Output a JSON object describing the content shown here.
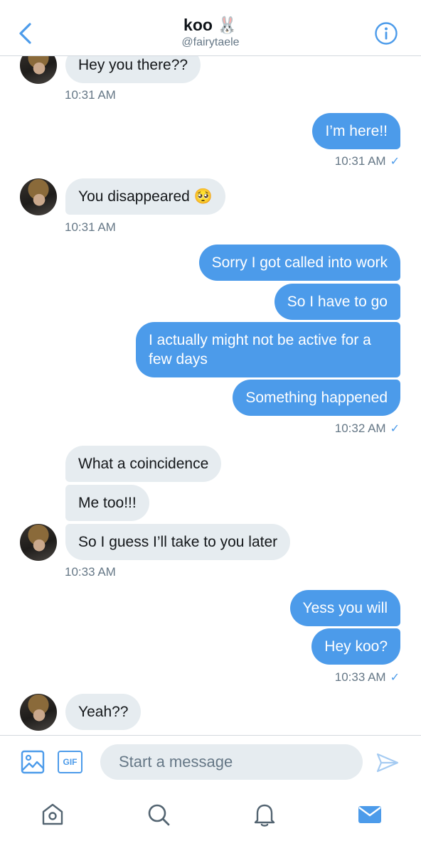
{
  "header": {
    "title": "koo 🐰",
    "handle": "@fairytaele"
  },
  "messages": [
    {
      "side": "in",
      "text": "Hey you there??"
    },
    {
      "side": "meta",
      "text": "10:31 AM"
    },
    {
      "side": "out",
      "text": "I’m here!!"
    },
    {
      "side": "meta",
      "text": "10:31 AM",
      "read": "✓"
    },
    {
      "side": "in",
      "text": "You disappeared 🥺"
    },
    {
      "side": "meta",
      "text": "10:31 AM"
    },
    {
      "side": "out",
      "text": "Sorry I got called into work"
    },
    {
      "side": "out",
      "text": "So I have to go"
    },
    {
      "side": "out",
      "text": "I actually might not be active for a few days"
    },
    {
      "side": "out",
      "text": "Something happened"
    },
    {
      "side": "meta",
      "text": "10:32 AM",
      "read": "✓"
    },
    {
      "side": "in",
      "text": "What a coincidence"
    },
    {
      "side": "in",
      "text": "Me too!!!"
    },
    {
      "side": "in",
      "text": "So I guess I’ll take to you later"
    },
    {
      "side": "meta",
      "text": "10:33 AM"
    },
    {
      "side": "out",
      "text": "Yess you will"
    },
    {
      "side": "out",
      "text": "Hey koo?"
    },
    {
      "side": "meta",
      "text": "10:33 AM",
      "read": "✓"
    },
    {
      "side": "in",
      "text": "Yeah??"
    }
  ],
  "composer": {
    "gif_label": "GIF",
    "placeholder": "Start a message"
  },
  "icons": {
    "back": "chevron-left-icon",
    "info": "info-icon",
    "image": "image-icon",
    "gif": "gif-icon",
    "send": "send-icon",
    "home": "home-icon",
    "search": "search-icon",
    "notifications": "bell-icon",
    "messages": "mail-icon"
  },
  "colors": {
    "accent": "#4c9bea",
    "incoming_bubble": "#e6ecf0",
    "muted_text": "#657786"
  }
}
